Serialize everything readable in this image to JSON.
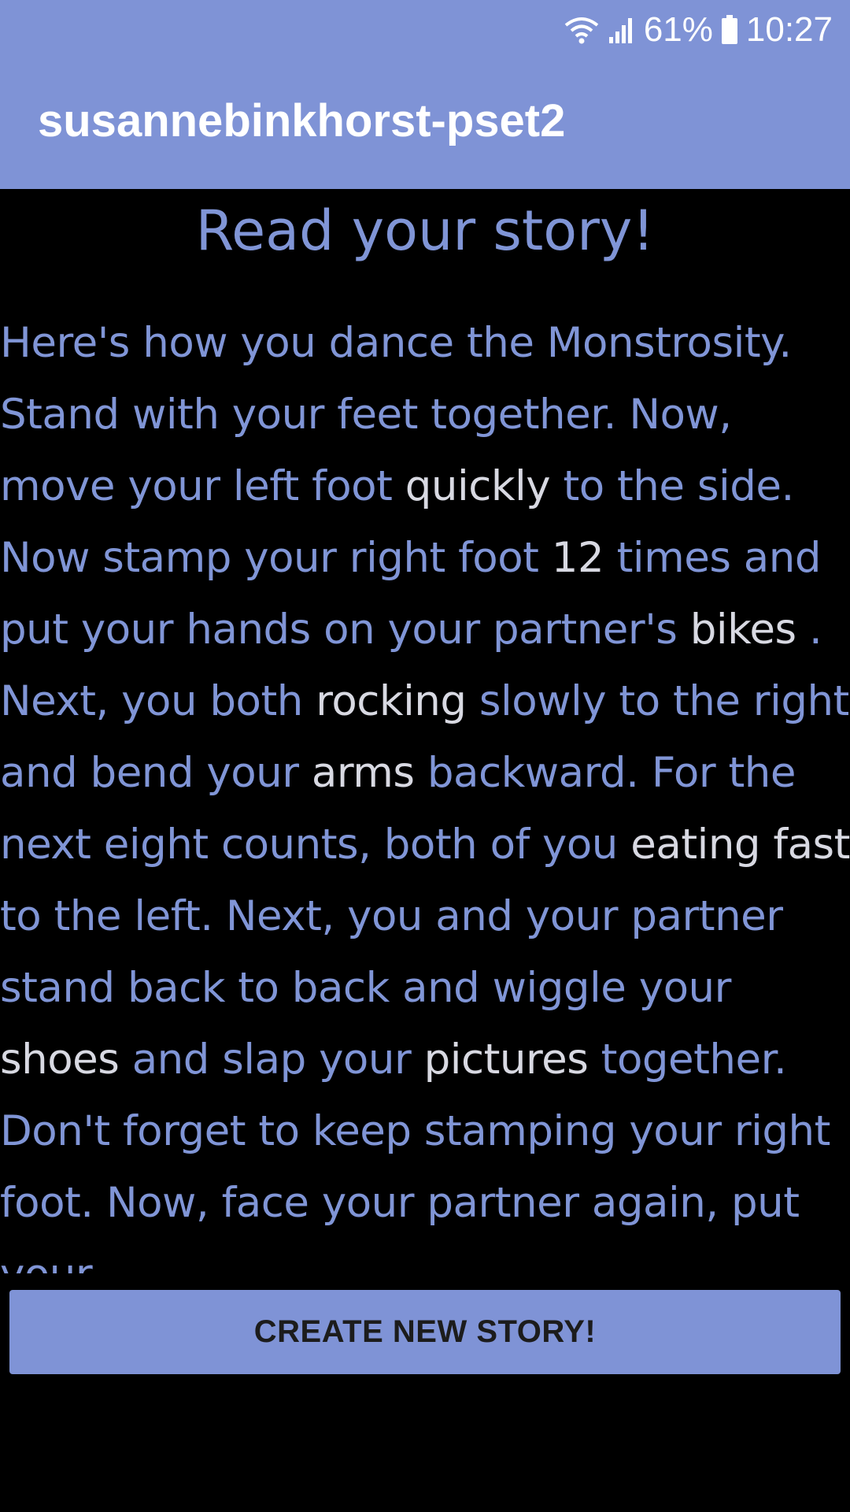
{
  "status_bar": {
    "battery_percent": "61%",
    "time": "10:27",
    "icons": [
      "wifi-icon",
      "signal-icon",
      "battery-icon"
    ]
  },
  "app_bar": {
    "title": "susannebinkhorst-pset2"
  },
  "main": {
    "heading": "Read your story!",
    "story": {
      "segments": [
        {
          "t": "Here's how you dance the Monstrosity. Stand with your feet together. Now, move your left foot "
        },
        {
          "w": "quickly"
        },
        {
          "t": " to the side. Now stamp your right foot "
        },
        {
          "w": "12"
        },
        {
          "t": " times and put your hands on your partner's "
        },
        {
          "w": "bikes"
        },
        {
          "t": " . Next, you both "
        },
        {
          "w": "rocking"
        },
        {
          "t": " slowly to the right and bend your "
        },
        {
          "w": "arms"
        },
        {
          "t": " backward. For the next eight counts, both of you "
        },
        {
          "w": "eating fast"
        },
        {
          "t": " to the left. Next, you and your partner stand back to back and wiggle your "
        },
        {
          "w": "shoes"
        },
        {
          "t": " and slap your "
        },
        {
          "w": "pictures"
        },
        {
          "t": " together. Don't forget to keep stamping your right foot. Now, face your partner again, put your"
        }
      ]
    },
    "create_button_label": "CREATE NEW STORY!"
  },
  "colors": {
    "accent": "#7f93d6",
    "background": "#000000",
    "story_text": "#8095d6",
    "filled_word": "#d8d9e2"
  }
}
